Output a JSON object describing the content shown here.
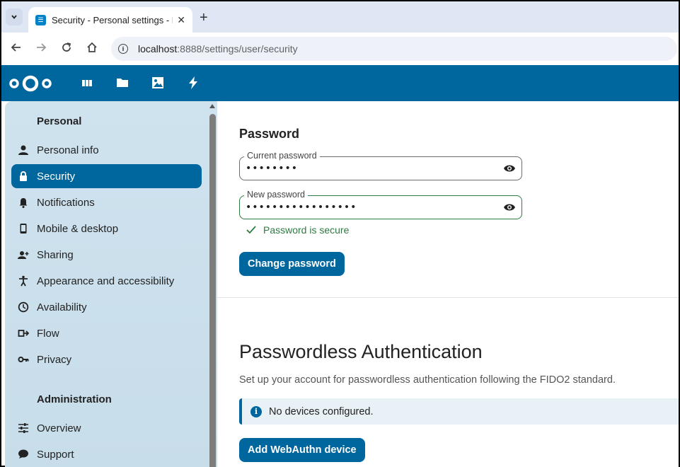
{
  "browser": {
    "tab_title": "Security - Personal settings - Ne",
    "tab_close": "✕",
    "new_tab": "+",
    "url_host": "localhost",
    "url_path": ":8888/settings/user/security"
  },
  "header": {
    "apps": [
      "dashboard-icon",
      "files-icon",
      "photos-icon",
      "activity-icon"
    ],
    "brand_color": "#00679e"
  },
  "sidebar": {
    "personal_title": "Personal",
    "items": [
      {
        "label": "Personal info",
        "icon": "user-icon"
      },
      {
        "label": "Security",
        "icon": "lock-icon",
        "active": true
      },
      {
        "label": "Notifications",
        "icon": "bell-icon"
      },
      {
        "label": "Mobile & desktop",
        "icon": "phone-icon"
      },
      {
        "label": "Sharing",
        "icon": "share-icon"
      },
      {
        "label": "Appearance and accessibility",
        "icon": "accessibility-icon"
      },
      {
        "label": "Availability",
        "icon": "clock-icon"
      },
      {
        "label": "Flow",
        "icon": "flow-icon"
      },
      {
        "label": "Privacy",
        "icon": "key-icon"
      }
    ],
    "admin_title": "Administration",
    "admin_items": [
      {
        "label": "Overview",
        "icon": "sliders-icon"
      },
      {
        "label": "Support",
        "icon": "chat-icon"
      }
    ]
  },
  "main": {
    "password_heading": "Password",
    "current_password_label": "Current password",
    "current_password_value": "••••••••",
    "new_password_label": "New password",
    "new_password_value": "•••••••••••••••••",
    "secure_message": "Password is secure",
    "change_password_button": "Change password",
    "passwordless_heading": "Passwordless Authentication",
    "passwordless_desc": "Set up your account for passwordless authentication following the FIDO2 standard.",
    "no_devices": "No devices configured.",
    "add_device_button": "Add WebAuthn device"
  }
}
